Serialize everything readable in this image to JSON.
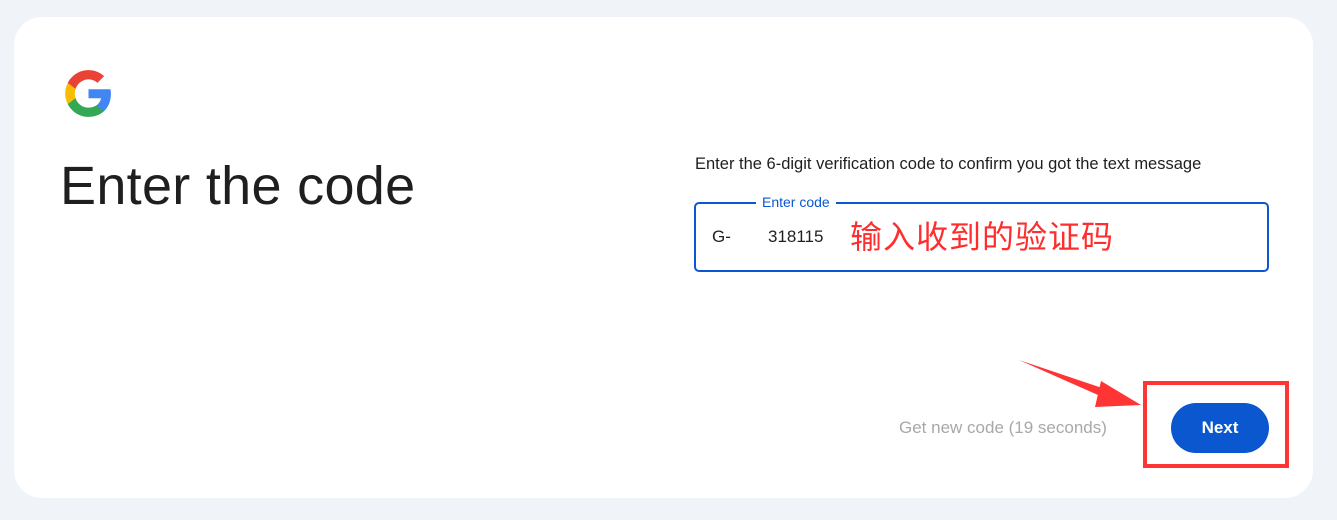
{
  "page": {
    "title": "Enter the code",
    "description": "Enter the 6-digit verification code to confirm you got the text message"
  },
  "logo": {
    "icon": "google-g-logo",
    "colors": [
      "#4285F4",
      "#EA4335",
      "#FBBC05",
      "#34A853"
    ]
  },
  "code_field": {
    "label": "Enter code",
    "prefix": "G-",
    "value": "318115"
  },
  "annotation": {
    "text": "输入收到的验证码",
    "color": "#ff2d2d"
  },
  "actions": {
    "resend_label": "Get new code (19 seconds)",
    "next_label": "Next"
  },
  "colors": {
    "accent": "#0b57d0",
    "background": "#f0f4f9",
    "annotation": "#ff3535"
  }
}
